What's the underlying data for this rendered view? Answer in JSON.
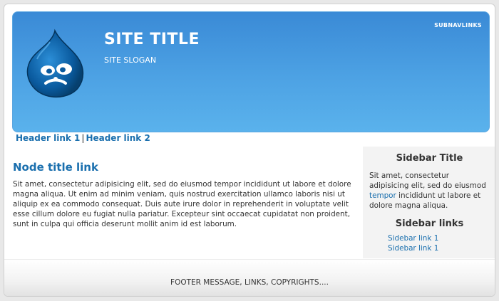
{
  "header": {
    "site_title": "SITE TITLE",
    "site_slogan": "SITE SLOGAN",
    "subnav_label": "SUBNAVLINKS",
    "logo_icon": "drupal-drop-logo-icon",
    "links": [
      {
        "label": "Header link 1"
      },
      {
        "label": "Header link 2"
      }
    ]
  },
  "main": {
    "node_title": "Node title link",
    "node_body": "Sit amet, consectetur adipisicing elit, sed do eiusmod tempor incididunt ut labore et dolore magna aliqua. Ut enim ad minim veniam, quis nostrud exercitation ullamco laboris nisi ut aliquip ex ea commodo consequat. Duis aute irure dolor in reprehenderit in voluptate velit esse cillum dolore eu fugiat nulla pariatur. Excepteur sint occaecat cupidatat non proident, sunt in culpa qui officia deserunt mollit anim id est laborum."
  },
  "sidebar": {
    "title": "Sidebar Title",
    "text_before": "Sit amet, consectetur adipisicing elit, sed do eiusmod ",
    "text_link": "tempor",
    "text_after": " incididunt ut labore et dolore magna aliqua.",
    "links_title": "Sidebar links",
    "links": [
      {
        "label": "Sidebar link 1"
      },
      {
        "label": "Sidebar link 1"
      }
    ]
  },
  "footer": {
    "message": "FOOTER MESSAGE, LINKS, COPYRIGHTS...."
  },
  "colors": {
    "header_gradient_top": "#3a8ad6",
    "header_gradient_bottom": "#5ab2ec",
    "link": "#1a6fae",
    "sidebar_bg": "#f3f3f3"
  }
}
